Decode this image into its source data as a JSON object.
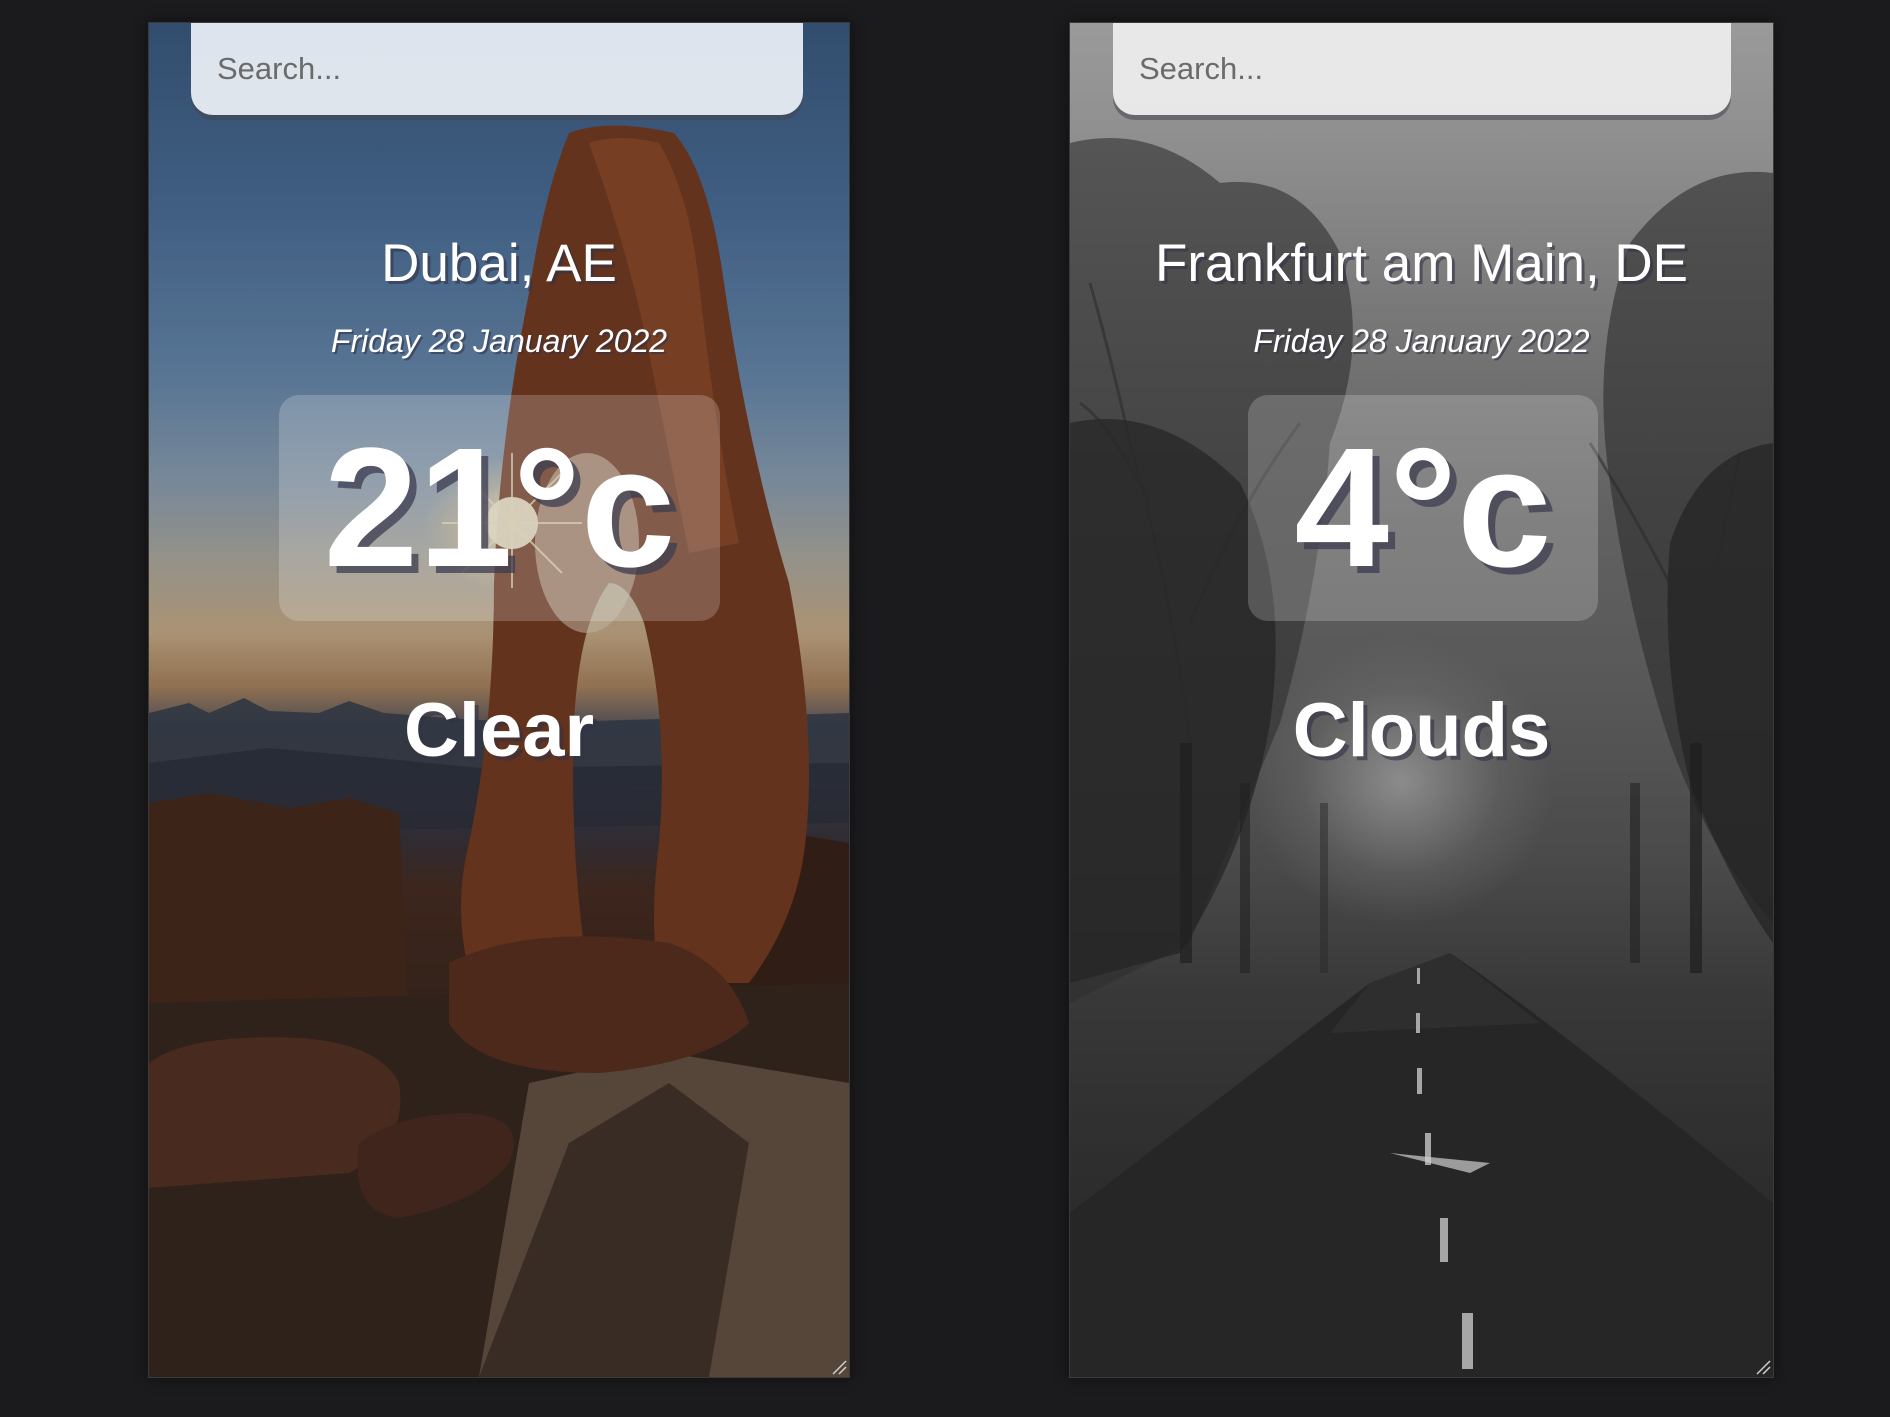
{
  "cards": [
    {
      "search_placeholder": "Search...",
      "location": "Dubai, AE",
      "date": "Friday 28 January 2022",
      "temperature": "21°c",
      "condition": "Clear",
      "background": "desert-rock-arch"
    },
    {
      "search_placeholder": "Search...",
      "location": "Frankfurt am Main, DE",
      "date": "Friday 28 January 2022",
      "temperature": "4°c",
      "condition": "Clouds",
      "background": "foggy-forest-road"
    }
  ],
  "colors": {
    "page_background": "#1b1b1d",
    "text": "#ffffff",
    "search_bar": "#eceff4"
  },
  "icons": {
    "resize": "resize-grip-icon"
  }
}
